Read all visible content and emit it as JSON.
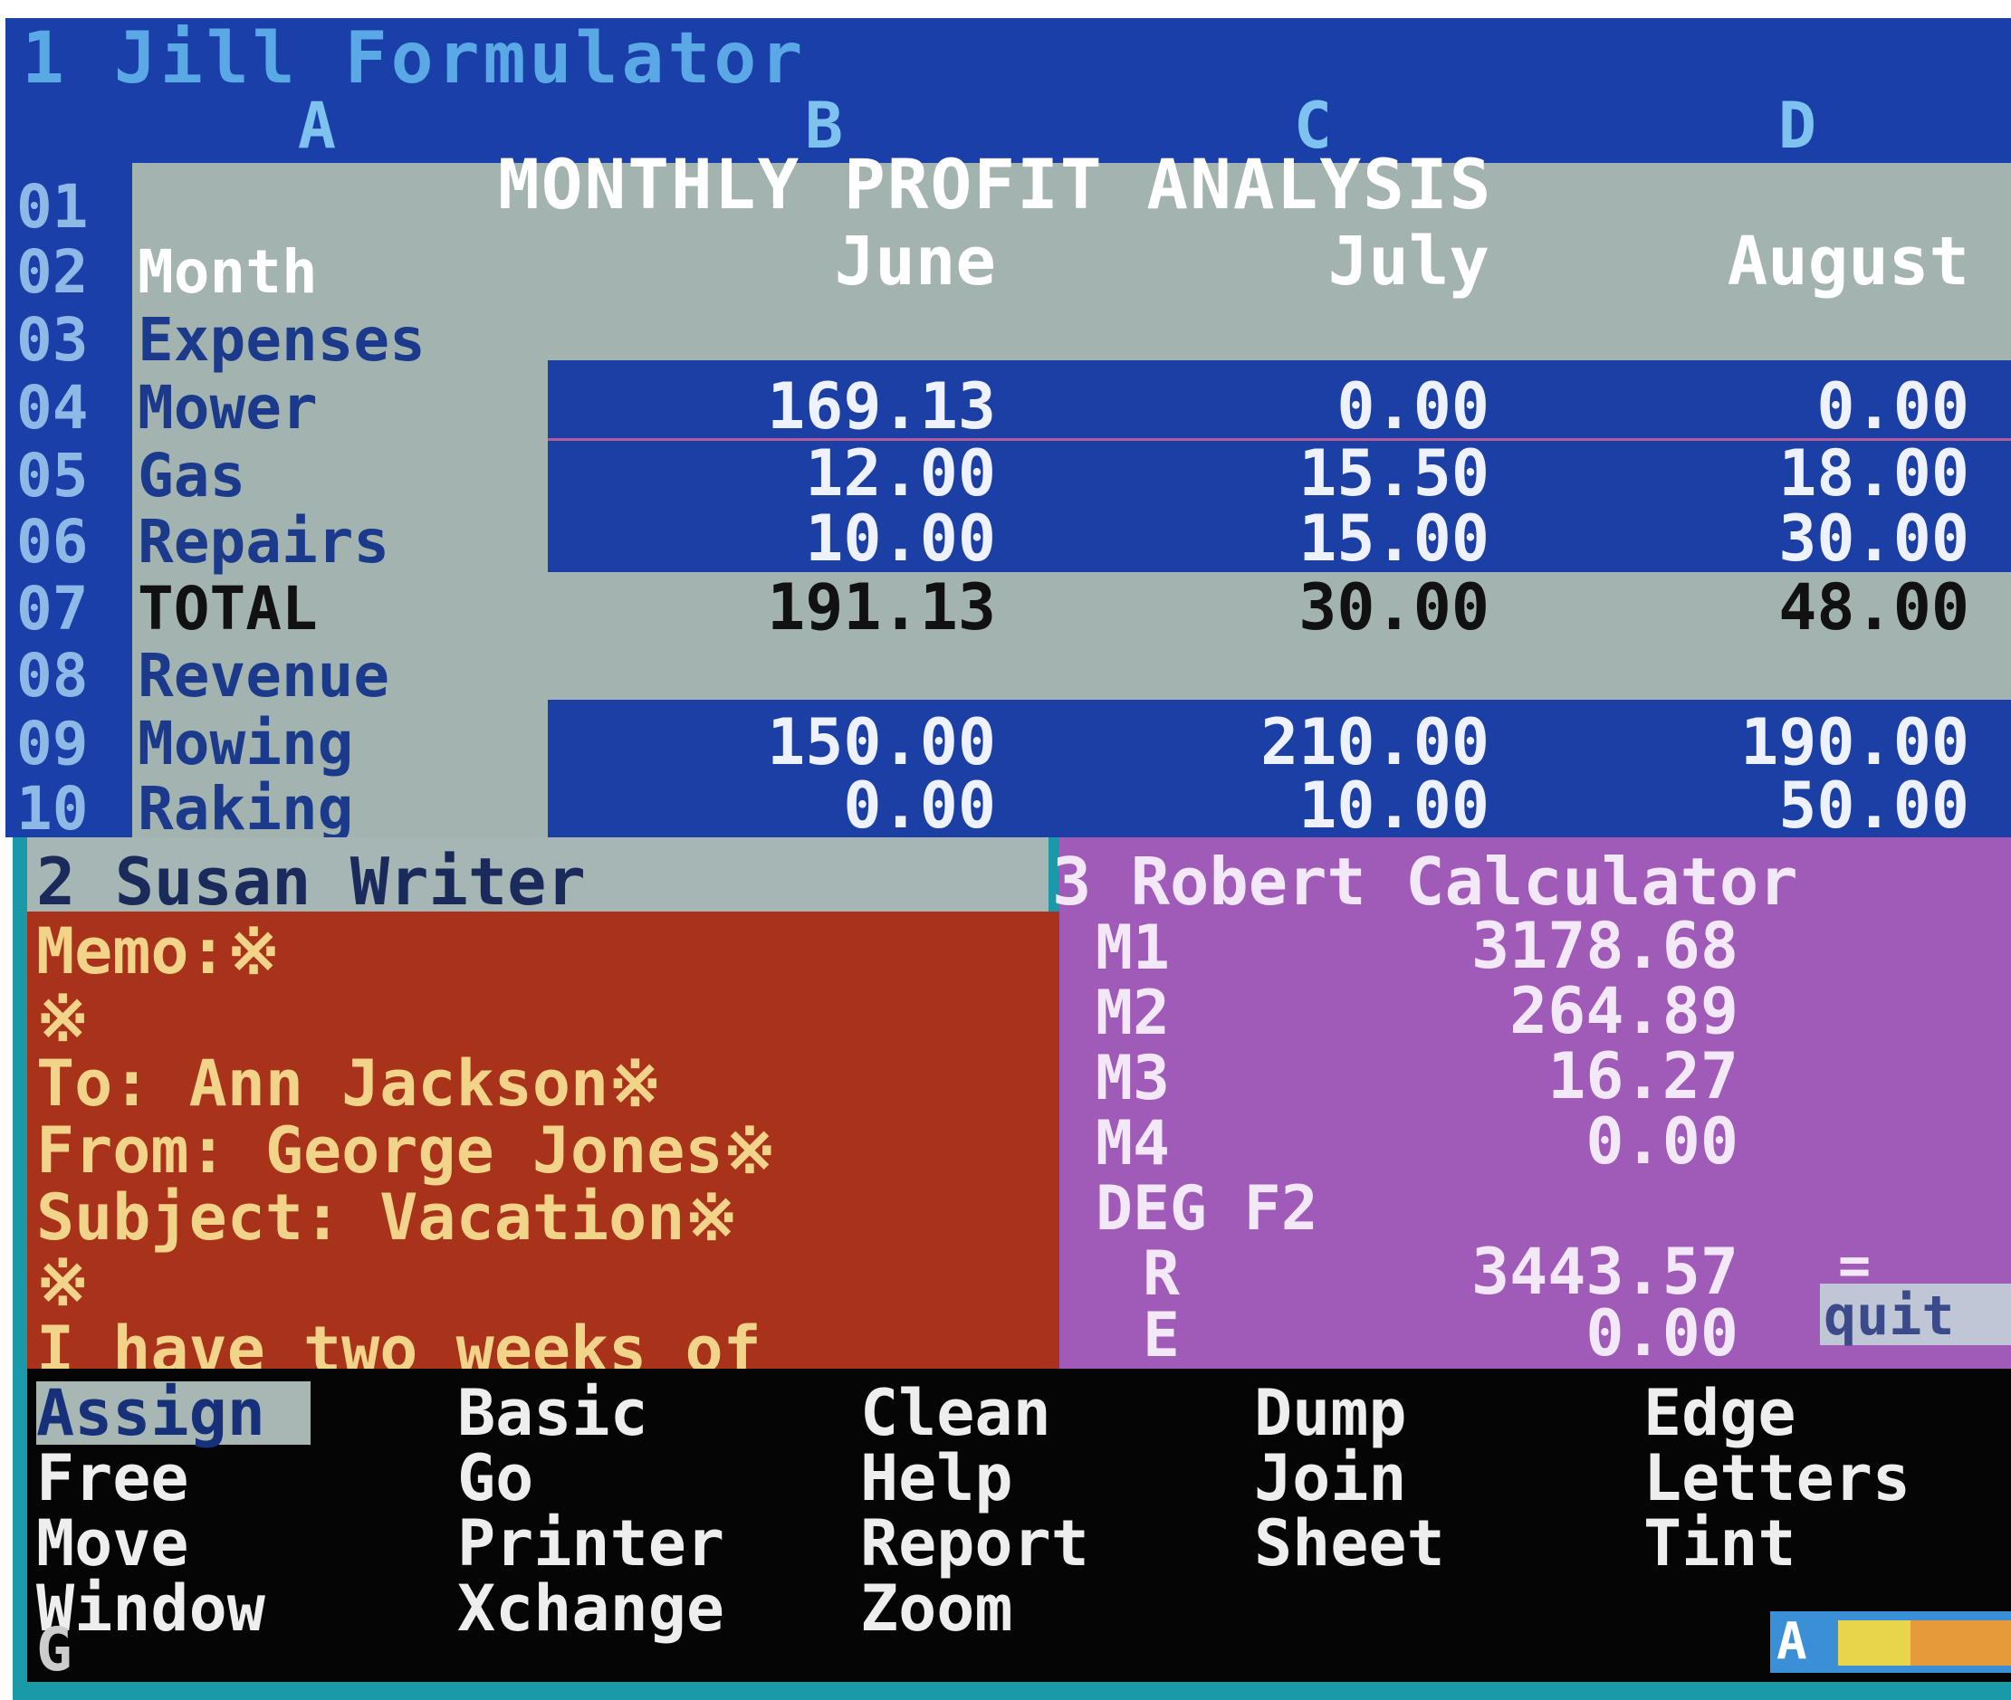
{
  "window1": {
    "title": "1 Jill Formulator",
    "columns": [
      "A",
      "B",
      "C",
      "D"
    ],
    "banner": "MONTHLY PROFIT ANALYSIS",
    "rows": [
      {
        "num": "01",
        "label": ""
      },
      {
        "num": "02",
        "label": "Month",
        "values": [
          "June",
          "July",
          "August"
        ]
      },
      {
        "num": "03",
        "label": "Expenses"
      },
      {
        "num": "04",
        "label": "Mower",
        "values": [
          "169.13",
          "0.00",
          "0.00"
        ]
      },
      {
        "num": "05",
        "label": "Gas",
        "values": [
          "12.00",
          "15.50",
          "18.00"
        ]
      },
      {
        "num": "06",
        "label": "Repairs",
        "values": [
          "10.00",
          "15.00",
          "30.00"
        ]
      },
      {
        "num": "07",
        "label": "TOTAL",
        "values": [
          "191.13",
          "30.00",
          "48.00"
        ]
      },
      {
        "num": "08",
        "label": "Revenue"
      },
      {
        "num": "09",
        "label": "Mowing",
        "values": [
          "150.00",
          "210.00",
          "190.00"
        ]
      },
      {
        "num": "10",
        "label": "Raking",
        "values": [
          "0.00",
          "10.00",
          "50.00"
        ]
      }
    ]
  },
  "window2": {
    "title": "2 Susan Writer",
    "lines": [
      "Memo:※",
      "※",
      "To: Ann Jackson※",
      "From: George Jones※",
      "Subject: Vacation※",
      "※",
      "I have two weeks of"
    ]
  },
  "window3": {
    "title": "3 Robert Calculator",
    "memories": [
      {
        "label": "M1",
        "value": "3178.68"
      },
      {
        "label": "M2",
        "value": "264.89"
      },
      {
        "label": "M3",
        "value": "16.27"
      },
      {
        "label": "M4",
        "value": "0.00"
      }
    ],
    "mode": "DEG F2",
    "result_label": "R",
    "result_value": "3443.57",
    "equals": "=",
    "error_label": "E",
    "error_value": "0.00",
    "quit_label": "quit"
  },
  "menu": {
    "columns": [
      [
        "Assign",
        "Free",
        "Move",
        "Window"
      ],
      [
        "Basic",
        "Go",
        "Printer",
        "Xchange"
      ],
      [
        "Clean",
        "Help",
        "Report",
        "Zoom"
      ],
      [
        "Dump",
        "Join",
        "Sheet"
      ],
      [
        "Edge",
        "Letters",
        "Tint"
      ]
    ],
    "selected": "Assign",
    "prompt": "G",
    "status_letter": "A"
  },
  "colors": {
    "screen_bezel": "#1a9aa8",
    "sheet_blue": "#1b3fa8",
    "sheet_gray": "#a3b4b0",
    "writer_red": "#a8331a",
    "calculator_purple": "#a05ab8",
    "menu_black": "#050505"
  }
}
